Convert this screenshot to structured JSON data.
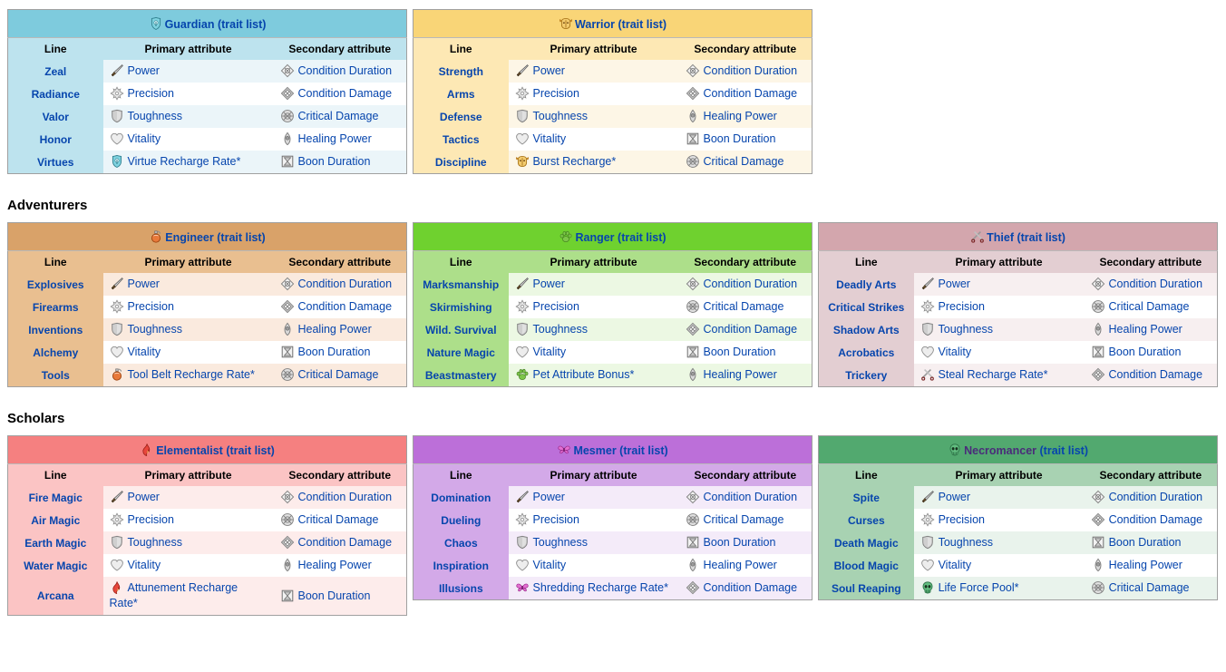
{
  "sections": [
    {
      "heading": "",
      "professions": [
        "guardian",
        "warrior"
      ]
    },
    {
      "heading": "Adventurers",
      "professions": [
        "engineer",
        "ranger",
        "thief"
      ]
    },
    {
      "heading": "Scholars",
      "professions": [
        "elementalist",
        "mesmer",
        "necromancer"
      ]
    }
  ],
  "columns": {
    "line": "Line",
    "primary": "Primary attribute",
    "secondary": "Secondary attribute"
  },
  "trait_list_label": "(trait list)",
  "professions": {
    "guardian": {
      "name": "Guardian",
      "icon": "guardian-icon",
      "header_color": "#7ecbdd",
      "body_color": "#bde3ee",
      "rows": [
        {
          "line": "Zeal",
          "primary": "Power",
          "primary_icon": "power-icon",
          "secondary": "Condition Duration",
          "secondary_icon": "condition-duration-icon"
        },
        {
          "line": "Radiance",
          "primary": "Precision",
          "primary_icon": "precision-icon",
          "secondary": "Condition Damage",
          "secondary_icon": "condition-damage-icon"
        },
        {
          "line": "Valor",
          "primary": "Toughness",
          "primary_icon": "toughness-icon",
          "secondary": "Critical Damage",
          "secondary_icon": "critical-damage-icon"
        },
        {
          "line": "Honor",
          "primary": "Vitality",
          "primary_icon": "vitality-icon",
          "secondary": "Healing Power",
          "secondary_icon": "healing-power-icon"
        },
        {
          "line": "Virtues",
          "primary": "Virtue Recharge Rate*",
          "primary_icon": "guardian-icon",
          "secondary": "Boon Duration",
          "secondary_icon": "boon-duration-icon"
        }
      ]
    },
    "warrior": {
      "name": "Warrior",
      "icon": "warrior-icon",
      "header_color": "#f9d577",
      "body_color": "#fde8b4",
      "rows": [
        {
          "line": "Strength",
          "primary": "Power",
          "primary_icon": "power-icon",
          "secondary": "Condition Duration",
          "secondary_icon": "condition-duration-icon"
        },
        {
          "line": "Arms",
          "primary": "Precision",
          "primary_icon": "precision-icon",
          "secondary": "Condition Damage",
          "secondary_icon": "condition-damage-icon"
        },
        {
          "line": "Defense",
          "primary": "Toughness",
          "primary_icon": "toughness-icon",
          "secondary": "Healing Power",
          "secondary_icon": "healing-power-icon"
        },
        {
          "line": "Tactics",
          "primary": "Vitality",
          "primary_icon": "vitality-icon",
          "secondary": "Boon Duration",
          "secondary_icon": "boon-duration-icon"
        },
        {
          "line": "Discipline",
          "primary": "Burst Recharge*",
          "primary_icon": "warrior-icon",
          "secondary": "Critical Damage",
          "secondary_icon": "critical-damage-icon"
        }
      ]
    },
    "engineer": {
      "name": "Engineer",
      "icon": "engineer-icon",
      "header_color": "#d9a269",
      "body_color": "#e9bf90",
      "rows": [
        {
          "line": "Explosives",
          "primary": "Power",
          "primary_icon": "power-icon",
          "secondary": "Condition Duration",
          "secondary_icon": "condition-duration-icon"
        },
        {
          "line": "Firearms",
          "primary": "Precision",
          "primary_icon": "precision-icon",
          "secondary": "Condition Damage",
          "secondary_icon": "condition-damage-icon"
        },
        {
          "line": "Inventions",
          "primary": "Toughness",
          "primary_icon": "toughness-icon",
          "secondary": "Healing Power",
          "secondary_icon": "healing-power-icon"
        },
        {
          "line": "Alchemy",
          "primary": "Vitality",
          "primary_icon": "vitality-icon",
          "secondary": "Boon Duration",
          "secondary_icon": "boon-duration-icon"
        },
        {
          "line": "Tools",
          "primary": "Tool Belt Recharge Rate*",
          "primary_icon": "engineer-icon",
          "secondary": "Critical Damage",
          "secondary_icon": "critical-damage-icon"
        }
      ]
    },
    "ranger": {
      "name": "Ranger",
      "icon": "ranger-icon",
      "header_color": "#6fd12f",
      "body_color": "#addf8a",
      "rows": [
        {
          "line": "Marksmanship",
          "primary": "Power",
          "primary_icon": "power-icon",
          "secondary": "Condition Duration",
          "secondary_icon": "condition-duration-icon"
        },
        {
          "line": "Skirmishing",
          "primary": "Precision",
          "primary_icon": "precision-icon",
          "secondary": "Critical Damage",
          "secondary_icon": "critical-damage-icon"
        },
        {
          "line": "Wild. Survival",
          "primary": "Toughness",
          "primary_icon": "toughness-icon",
          "secondary": "Condition Damage",
          "secondary_icon": "condition-damage-icon"
        },
        {
          "line": "Nature Magic",
          "primary": "Vitality",
          "primary_icon": "vitality-icon",
          "secondary": "Boon Duration",
          "secondary_icon": "boon-duration-icon"
        },
        {
          "line": "Beastmastery",
          "primary": "Pet Attribute Bonus*",
          "primary_icon": "ranger-icon",
          "secondary": "Healing Power",
          "secondary_icon": "healing-power-icon"
        }
      ]
    },
    "thief": {
      "name": "Thief",
      "icon": "thief-icon",
      "header_color": "#d3a6ad",
      "body_color": "#e3ced2",
      "rows": [
        {
          "line": "Deadly Arts",
          "primary": "Power",
          "primary_icon": "power-icon",
          "secondary": "Condition Duration",
          "secondary_icon": "condition-duration-icon"
        },
        {
          "line": "Critical Strikes",
          "primary": "Precision",
          "primary_icon": "precision-icon",
          "secondary": "Critical Damage",
          "secondary_icon": "critical-damage-icon"
        },
        {
          "line": "Shadow Arts",
          "primary": "Toughness",
          "primary_icon": "toughness-icon",
          "secondary": "Healing Power",
          "secondary_icon": "healing-power-icon"
        },
        {
          "line": "Acrobatics",
          "primary": "Vitality",
          "primary_icon": "vitality-icon",
          "secondary": "Boon Duration",
          "secondary_icon": "boon-duration-icon"
        },
        {
          "line": "Trickery",
          "primary": "Steal Recharge Rate*",
          "primary_icon": "thief-icon",
          "secondary": "Condition Damage",
          "secondary_icon": "condition-damage-icon"
        }
      ]
    },
    "elementalist": {
      "name": "Elementalist",
      "icon": "elementalist-icon",
      "header_color": "#f58080",
      "body_color": "#fbc4c4",
      "rows": [
        {
          "line": "Fire Magic",
          "primary": "Power",
          "primary_icon": "power-icon",
          "secondary": "Condition Duration",
          "secondary_icon": "condition-duration-icon"
        },
        {
          "line": "Air Magic",
          "primary": "Precision",
          "primary_icon": "precision-icon",
          "secondary": "Critical Damage",
          "secondary_icon": "critical-damage-icon"
        },
        {
          "line": "Earth Magic",
          "primary": "Toughness",
          "primary_icon": "toughness-icon",
          "secondary": "Condition Damage",
          "secondary_icon": "condition-damage-icon"
        },
        {
          "line": "Water Magic",
          "primary": "Vitality",
          "primary_icon": "vitality-icon",
          "secondary": "Healing Power",
          "secondary_icon": "healing-power-icon"
        },
        {
          "line": "Arcana",
          "primary": "Attunement Recharge Rate*",
          "primary_icon": "elementalist-icon",
          "secondary": "Boon Duration",
          "secondary_icon": "boon-duration-icon"
        }
      ]
    },
    "mesmer": {
      "name": "Mesmer",
      "icon": "mesmer-icon",
      "header_color": "#bc6fd9",
      "body_color": "#d3a9e8",
      "rows": [
        {
          "line": "Domination",
          "primary": "Power",
          "primary_icon": "power-icon",
          "secondary": "Condition Duration",
          "secondary_icon": "condition-duration-icon"
        },
        {
          "line": "Dueling",
          "primary": "Precision",
          "primary_icon": "precision-icon",
          "secondary": "Critical Damage",
          "secondary_icon": "critical-damage-icon"
        },
        {
          "line": "Chaos",
          "primary": "Toughness",
          "primary_icon": "toughness-icon",
          "secondary": "Boon Duration",
          "secondary_icon": "boon-duration-icon"
        },
        {
          "line": "Inspiration",
          "primary": "Vitality",
          "primary_icon": "vitality-icon",
          "secondary": "Healing Power",
          "secondary_icon": "healing-power-icon"
        },
        {
          "line": "Illusions",
          "primary": "Shredding Recharge Rate*",
          "primary_icon": "mesmer-icon",
          "secondary": "Condition Damage",
          "secondary_icon": "condition-damage-icon"
        }
      ]
    },
    "necromancer": {
      "name": "Necromancer",
      "icon": "necromancer-icon",
      "header_color": "#52a96f",
      "body_color": "#a8d2b2",
      "rows": [
        {
          "line": "Spite",
          "primary": "Power",
          "primary_icon": "power-icon",
          "secondary": "Condition Duration",
          "secondary_icon": "condition-duration-icon"
        },
        {
          "line": "Curses",
          "primary": "Precision",
          "primary_icon": "precision-icon",
          "secondary": "Condition Damage",
          "secondary_icon": "condition-damage-icon"
        },
        {
          "line": "Death Magic",
          "primary": "Toughness",
          "primary_icon": "toughness-icon",
          "secondary": "Boon Duration",
          "secondary_icon": "boon-duration-icon"
        },
        {
          "line": "Blood Magic",
          "primary": "Vitality",
          "primary_icon": "vitality-icon",
          "secondary": "Healing Power",
          "secondary_icon": "healing-power-icon"
        },
        {
          "line": "Soul Reaping",
          "primary": "Life Force Pool*",
          "primary_icon": "necromancer-icon",
          "secondary": "Critical Damage",
          "secondary_icon": "critical-damage-icon"
        }
      ]
    }
  }
}
